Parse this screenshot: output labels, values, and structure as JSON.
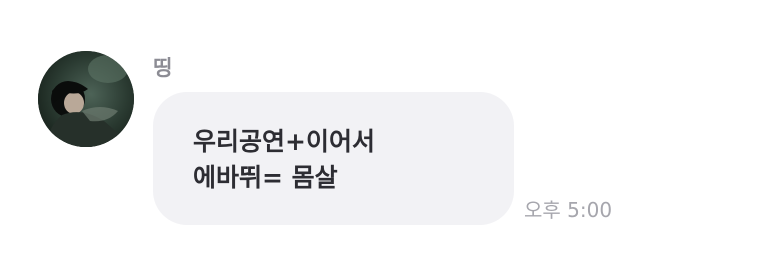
{
  "message": {
    "sender": "띵",
    "avatar_icon": "user-avatar-photo",
    "text_lines": [
      "우리공연+이어서",
      "에바뛰= 몸살"
    ],
    "timestamp": "오후 5:00"
  },
  "colors": {
    "bubble_background": "#f2f2f5",
    "message_text": "#2d2d33",
    "sender_text": "#8c8c94",
    "timestamp_text": "#a6a6ad"
  }
}
